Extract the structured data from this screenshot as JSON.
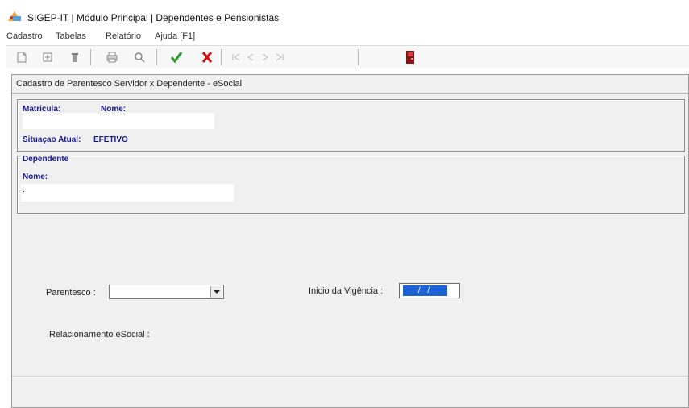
{
  "window": {
    "title": "SIGEP-IT | Módulo Principal | Dependentes e Pensionistas"
  },
  "menu": [
    {
      "label": "Cadastro"
    },
    {
      "label": "Tabelas"
    },
    {
      "label": "Relatório"
    },
    {
      "label": "Ajuda [F1]"
    }
  ],
  "toolbar": {
    "icons": [
      "new-doc-icon",
      "open-icon",
      "delete-icon",
      "print-icon",
      "search-icon",
      "confirm-check-icon",
      "cancel-x-icon",
      "first-record-icon",
      "prev-record-icon",
      "next-record-icon",
      "last-record-icon",
      "exit-door-icon"
    ],
    "confirm_color": "#2a9a2a",
    "cancel_color": "#d01010"
  },
  "form": {
    "title": "Cadastro de Parentesco Servidor x Dependente - eSocial",
    "servidor": {
      "matricula_label": "Matricula:",
      "nome_label": "Nome:",
      "situacao_label": "Situaçao Atual:",
      "situacao_value": "EFETIVO"
    },
    "dependente": {
      "group_label": "Dependente",
      "nome_label": "Nome:",
      "nome_value": "."
    },
    "parentesco_label": "Parentesco  :",
    "parentesco_value": "",
    "inicio_vigencia_label": "Inicio da Vigência :",
    "inicio_vigencia_value": "/ /",
    "relacionamento_label": "Relacionamento eSocial :"
  },
  "colors": {
    "label_blue": "#151a8c",
    "selection_blue": "#1e63d6",
    "window_bg": "#f0f0f0"
  }
}
